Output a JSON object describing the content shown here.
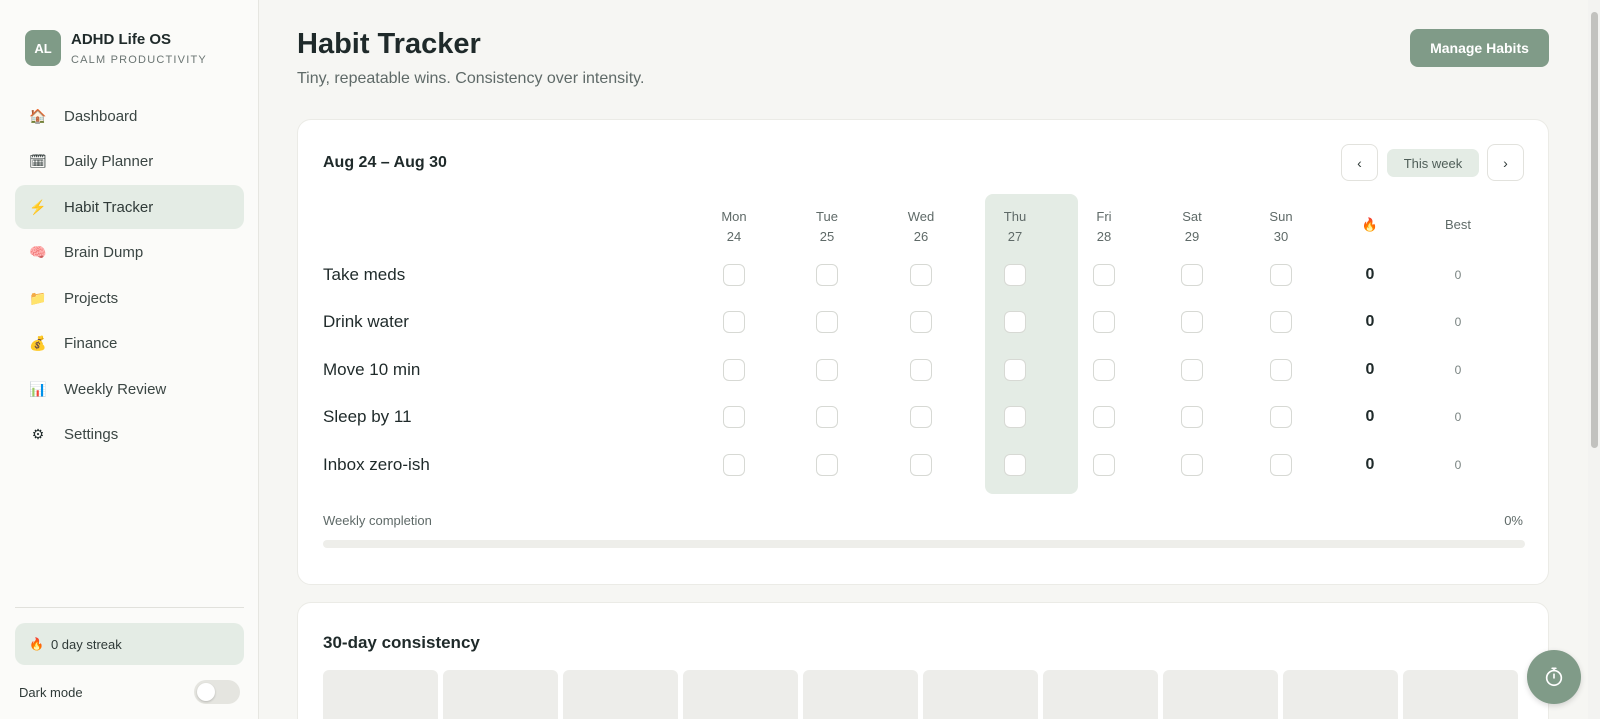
{
  "brand": {
    "initials": "AL",
    "name": "ADHD Life OS",
    "tagline": "CALM PRODUCTIVITY"
  },
  "sidebar": {
    "items": [
      {
        "label": "Dashboard",
        "icon": "house-icon",
        "glyph": "🏠",
        "active": false
      },
      {
        "label": "Daily Planner",
        "icon": "calendar-icon",
        "glyph": "🗓",
        "active": false
      },
      {
        "label": "Habit Tracker",
        "icon": "lightning-icon",
        "glyph": "⚡",
        "active": true
      },
      {
        "label": "Brain Dump",
        "icon": "brain-icon",
        "glyph": "🧠",
        "active": false
      },
      {
        "label": "Projects",
        "icon": "folder-icon",
        "glyph": "📁",
        "active": false
      },
      {
        "label": "Finance",
        "icon": "money-bag-icon",
        "glyph": "💰",
        "active": false
      },
      {
        "label": "Weekly Review",
        "icon": "bar-chart-icon",
        "glyph": "📊",
        "active": false
      },
      {
        "label": "Settings",
        "icon": "gear-icon",
        "glyph": "⚙",
        "active": false
      }
    ],
    "streak_label": "0 day streak",
    "dark_mode_label": "Dark mode",
    "dark_mode_on": false
  },
  "header": {
    "title": "Habit Tracker",
    "subtitle": "Tiny, repeatable wins. Consistency over intensity.",
    "manage_label": "Manage Habits"
  },
  "week": {
    "range": "Aug 24 – Aug 30",
    "prev_label": "‹",
    "next_label": "›",
    "this_week_label": "This week",
    "days": [
      {
        "name": "Mon",
        "date": "24",
        "today": false
      },
      {
        "name": "Tue",
        "date": "25",
        "today": false
      },
      {
        "name": "Wed",
        "date": "26",
        "today": false
      },
      {
        "name": "Thu",
        "date": "27",
        "today": true
      },
      {
        "name": "Fri",
        "date": "28",
        "today": false
      },
      {
        "name": "Sat",
        "date": "29",
        "today": false
      },
      {
        "name": "Sun",
        "date": "30",
        "today": false
      }
    ],
    "streak_header": "🔥",
    "best_header": "Best",
    "habits": [
      {
        "name": "Take meds",
        "checks": [
          false,
          false,
          false,
          false,
          false,
          false,
          false
        ],
        "streak": "0",
        "best": "0"
      },
      {
        "name": "Drink water",
        "checks": [
          false,
          false,
          false,
          false,
          false,
          false,
          false
        ],
        "streak": "0",
        "best": "0"
      },
      {
        "name": "Move 10 min",
        "checks": [
          false,
          false,
          false,
          false,
          false,
          false,
          false
        ],
        "streak": "0",
        "best": "0"
      },
      {
        "name": "Sleep by 11",
        "checks": [
          false,
          false,
          false,
          false,
          false,
          false,
          false
        ],
        "streak": "0",
        "best": "0"
      },
      {
        "name": "Inbox zero-ish",
        "checks": [
          false,
          false,
          false,
          false,
          false,
          false,
          false
        ],
        "streak": "0",
        "best": "0"
      }
    ],
    "completion_label": "Weekly completion",
    "completion_pct": "0%",
    "completion_value": 0
  },
  "consistency": {
    "title": "30-day consistency"
  },
  "colors": {
    "accent": "#809b88",
    "accent_soft": "#e4ece5"
  }
}
